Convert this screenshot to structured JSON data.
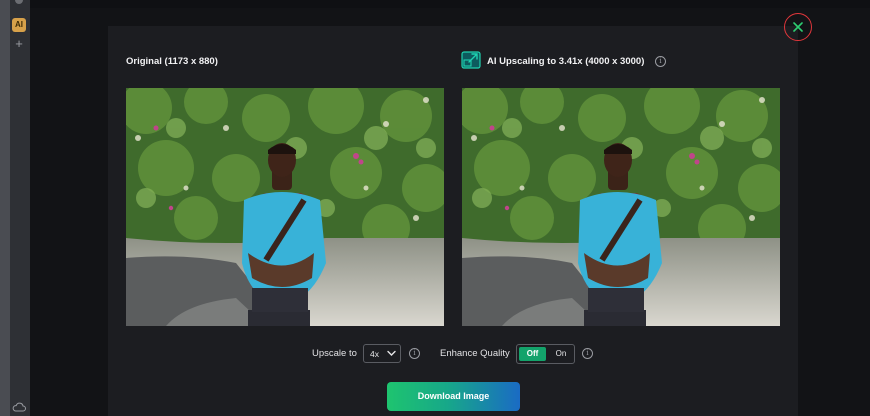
{
  "colors": {
    "accent_green": "#13a36b",
    "close_red": "#e0363b",
    "button_gradient_start": "#1ec46f",
    "button_gradient_end": "#1a6bc4",
    "modal_bg": "#1c1d21"
  },
  "sidebar": {
    "badge_label": "AI",
    "add_icon": "plus-icon",
    "bottom_icon": "cloud-icon"
  },
  "dialog": {
    "close_icon": "close-icon",
    "original": {
      "title": "Original (1173 x 880)"
    },
    "upscaled": {
      "icon": "upscale-arrow-icon",
      "title": "AI Upscaling to 3.41x (4000 x 3000)",
      "info_icon": "info-icon"
    }
  },
  "controls": {
    "upscale_label": "Upscale to",
    "upscale_value": "4x",
    "enhance_label": "Enhance Quality",
    "enhance_off_label": "Off",
    "enhance_on_label": "On",
    "enhance_selected": "Off",
    "info_glyph": "i"
  },
  "download": {
    "label": "Download Image"
  }
}
